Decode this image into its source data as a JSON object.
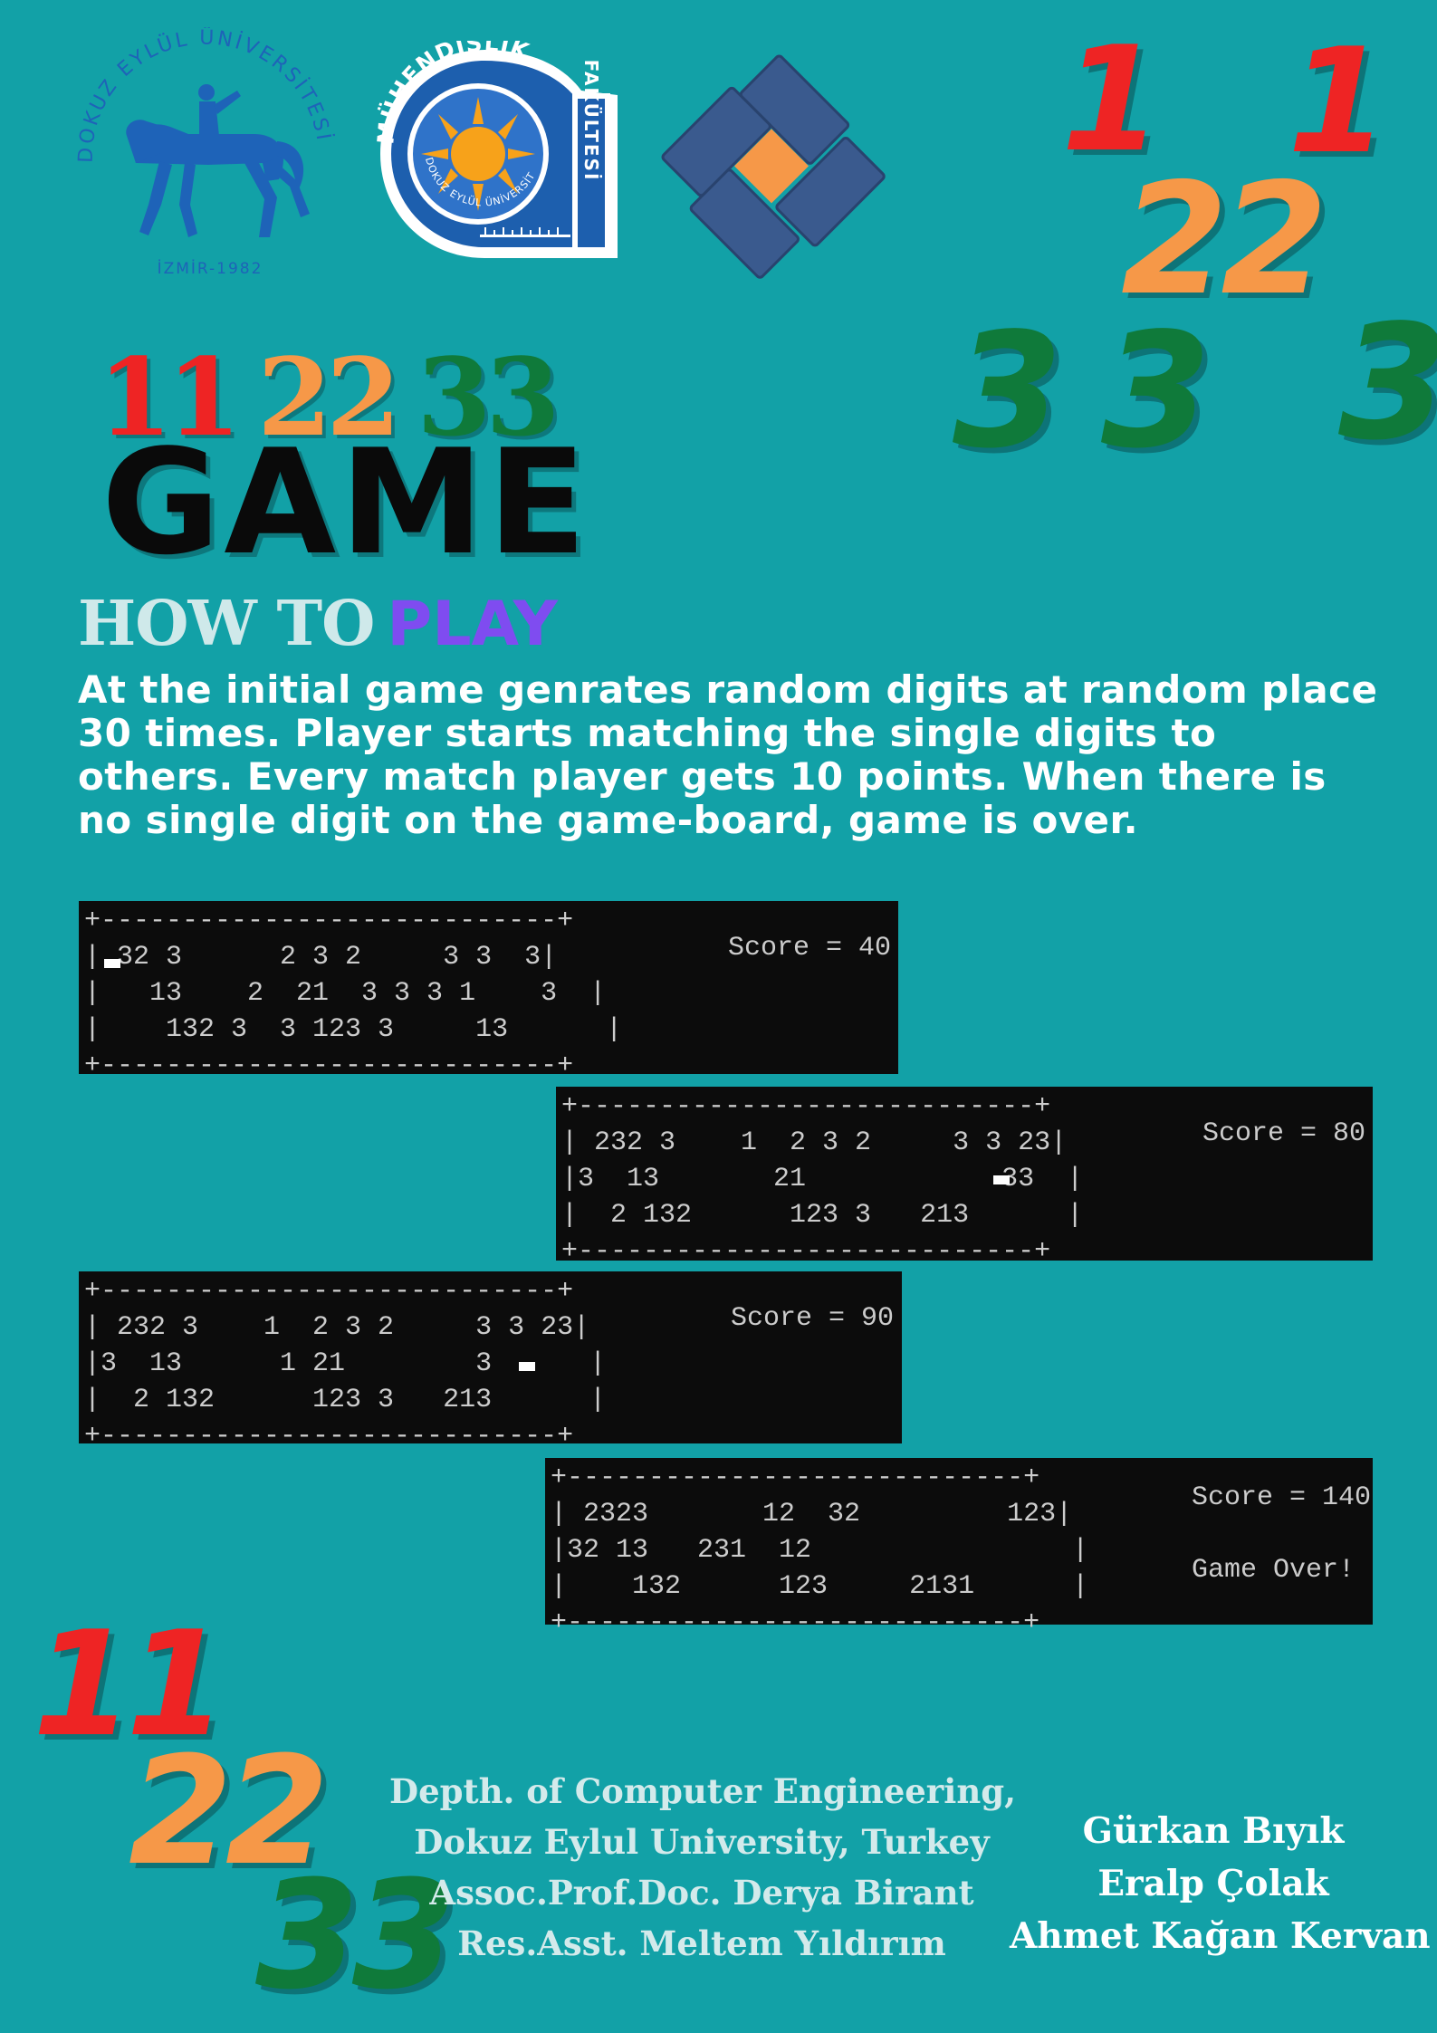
{
  "logos": {
    "deu": {
      "ring_text": "DOKUZ EYLÜL ÜNİVERSİTESİ",
      "bottom_text": "İZMİR-1982",
      "color": "#1e63b8"
    },
    "muhendislik": {
      "top_text": "MÜHENDİSLİK",
      "side_text": "FAKÜLTESİ",
      "inner_text": "DOKUZ EYLÜL ÜNİVERSİTESİ",
      "color": "#1d5fae",
      "sun_color": "#f7a21a"
    },
    "diamond": {
      "block_color": "#3a5a8e",
      "center_color": "#f69848"
    }
  },
  "decor": {
    "top_right": {
      "one": "1",
      "two": "22",
      "three": "3"
    },
    "bottom_left": {
      "ones": "11",
      "twos": "22",
      "threes": "33"
    }
  },
  "title": {
    "ones": "11",
    "twos": "22",
    "threes": "33",
    "game": "GAME",
    "colors": {
      "red": "#ee2424",
      "orange": "#f69848",
      "green": "#0f7a3a"
    }
  },
  "howto": {
    "how": "HOW TO",
    "play": "PLAY"
  },
  "instructions": "At the initial game genrates random digits at random place 30 times. Player starts matching the single digits to others. Every match player gets 10 points. When there is no single digit on the game-board, game is over.",
  "terminals": [
    {
      "board": "+----------------------------+\n| 32 3      2 3 2     3 3  3|\n|   13    2  21  3 3 3 1    3  |\n|    132 3  3 123 3     13      |\n+----------------------------+",
      "score": "Score = 40",
      "extra": ""
    },
    {
      "board": "+----------------------------+\n| 232 3    1  2 3 2     3 3 23|\n|3  13       21            33  |\n|  2 132      123 3   213      |\n+----------------------------+",
      "score": "Score = 80",
      "extra": ""
    },
    {
      "board": "+----------------------------+\n| 232 3    1  2 3 2     3 3 23|\n|3  13      1 21        3      |\n|  2 132      123 3   213      |\n+----------------------------+",
      "score": "Score = 90",
      "extra": ""
    },
    {
      "board": "+----------------------------+\n| 2323       12  32         123|\n|32 13   231  12                |\n|    132      123     2131      |\n+----------------------------+",
      "score": "Score = 140",
      "extra": "Game Over!"
    }
  ],
  "footer": {
    "dept_lines": [
      "Depth. of Computer Engineering,",
      "Dokuz Eylul University, Turkey",
      "Assoc.Prof.Doc. Derya Birant",
      "Res.Asst. Meltem Yıldırım"
    ],
    "authors": [
      "Gürkan Bıyık",
      "Eralp Çolak",
      "Ahmet Kağan Kervan"
    ]
  }
}
